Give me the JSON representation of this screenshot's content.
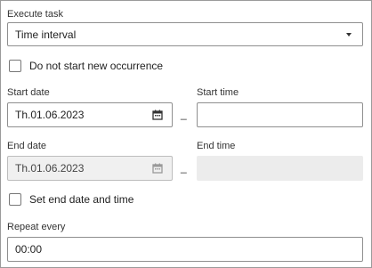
{
  "execute_task": {
    "label": "Execute task",
    "selected": "Time interval"
  },
  "do_not_start": {
    "label": "Do not start new occurrence",
    "checked": false
  },
  "start_date": {
    "label": "Start date",
    "value": "Th.01.06.2023",
    "icon": "calendar-icon"
  },
  "start_time": {
    "label": "Start time",
    "value": ""
  },
  "separator": "_",
  "end_date": {
    "label": "End date",
    "value": "Th.01.06.2023",
    "icon": "calendar-icon",
    "disabled": true
  },
  "end_time": {
    "label": "End time",
    "value": "",
    "disabled": true
  },
  "set_end": {
    "label": "Set end date and time",
    "checked": false
  },
  "repeat_every": {
    "label": "Repeat every",
    "value": "00:00"
  }
}
